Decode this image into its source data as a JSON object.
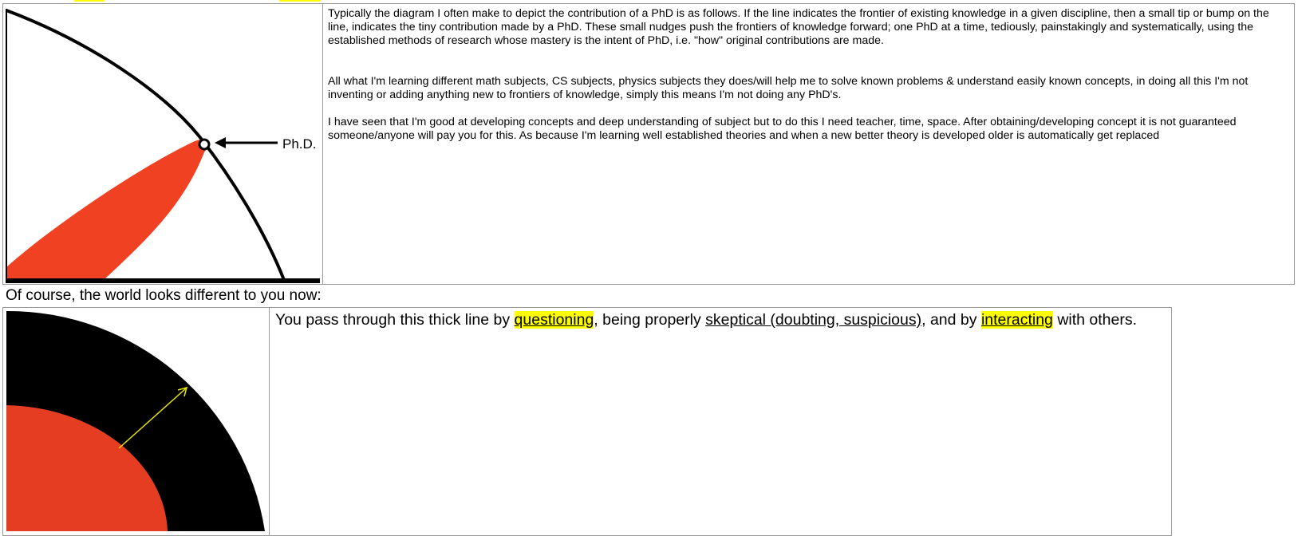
{
  "diagram_phd": {
    "label": "Ph.D."
  },
  "paragraphs": [
    "Typically the diagram I often make to depict the contribution of a PhD is as follows. If the line indicates the frontier of existing knowledge in a given discipline, then a small tip or bump on the line, indicates the tiny contribution made by a PhD. These small nudges push the frontiers of knowledge forward; one PhD at a time, tediously, painstakingly and systematically, using the established methods of research whose mastery is the intent of PhD, i.e. \"how\" original contributions are made.",
    "All what I'm learning different math subjects, CS subjects, physics subjects they does/will help me to solve known problems & understand easily known concepts, in doing all this I'm not inventing or adding anything new to frontiers of knowledge, simply this means I'm not doing any PhD's.",
    "I have seen that I'm good at developing concepts and deep understanding of subject but to do this I need teacher, time, space. After obtaining/developing concept it is not guaranteed someone/anyone will pay you for this. As because I'm learning well established theories and when a new better theory is developed older is automatically get replaced"
  ],
  "caption": "Of course, the world looks different to you now:",
  "sentence": {
    "part1": "You pass through this thick line by ",
    "highlight1": "questioning",
    "part2": ", being properly ",
    "underlined": "skeptical (doubting, suspicious)",
    "part3": ", and by ",
    "highlight2": "interacting",
    "part4": " with others."
  },
  "colors": {
    "accent_red": "#f04123",
    "highlight": "#ffff00",
    "arrow": "#e6e600"
  }
}
